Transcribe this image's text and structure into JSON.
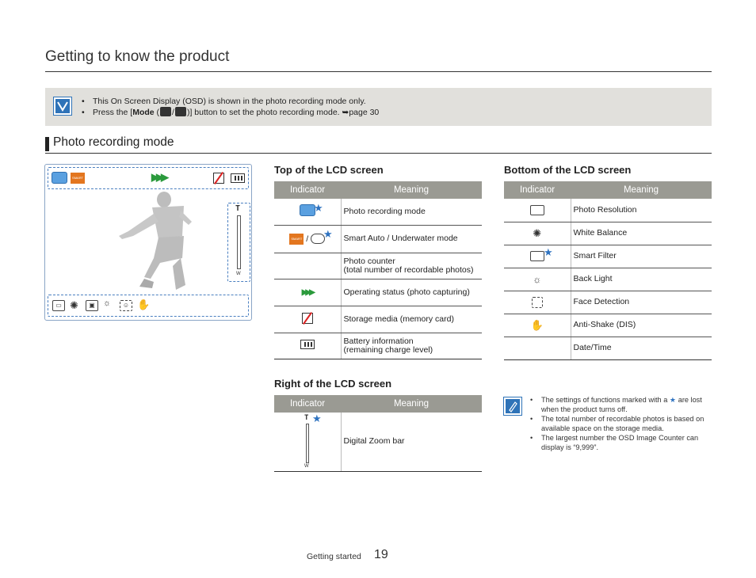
{
  "page": {
    "title": "Getting to know the product",
    "section_title": "Photo recording mode",
    "footer_label": "Getting started",
    "page_number": "19"
  },
  "note": {
    "icon": "note-check-icon",
    "line1": "This On Screen Display (OSD) is shown in the photo recording mode only.",
    "line2_pre": "Press the [",
    "line2_bold": "Mode",
    "line2_mid": " (",
    "line2_post": ")] button to set the photo recording mode. ",
    "line2_ref": "➥page 30"
  },
  "top_table": {
    "heading": "Top of the LCD screen",
    "col_indicator": "Indicator",
    "col_meaning": "Meaning",
    "rows": [
      {
        "icon": "photo-mode-icon",
        "meaning": "Photo recording mode",
        "star": true
      },
      {
        "icon": "smart-auto-underwater-icon",
        "sep": "/",
        "meaning": "Smart Auto / Underwater mode",
        "star": true
      },
      {
        "icon": "",
        "meaning_1": "Photo counter",
        "meaning_2": "(total number of recordable photos)"
      },
      {
        "icon": "operating-status-icon",
        "meaning": "Operating status (photo capturing)"
      },
      {
        "icon": "storage-media-icon",
        "meaning": "Storage media (memory card)"
      },
      {
        "icon": "battery-icon",
        "meaning_1": "Battery information",
        "meaning_2": "(remaining charge level)"
      }
    ]
  },
  "bottom_table": {
    "heading": "Bottom of the LCD screen",
    "col_indicator": "Indicator",
    "col_meaning": "Meaning",
    "rows": [
      {
        "icon": "photo-resolution-icon",
        "meaning": "Photo Resolution"
      },
      {
        "icon": "white-balance-icon",
        "meaning": "White Balance"
      },
      {
        "icon": "smart-filter-icon",
        "meaning": "Smart Filter",
        "star": true
      },
      {
        "icon": "back-light-icon",
        "meaning": "Back Light"
      },
      {
        "icon": "face-detection-icon",
        "meaning": "Face Detection"
      },
      {
        "icon": "anti-shake-icon",
        "meaning": "Anti-Shake (DIS)"
      },
      {
        "icon": "",
        "meaning": "Date/Time"
      }
    ]
  },
  "right_table": {
    "heading": "Right of the LCD screen",
    "col_indicator": "Indicator",
    "col_meaning": "Meaning",
    "rows": [
      {
        "icon": "digital-zoom-bar-icon",
        "meaning": "Digital Zoom bar",
        "star": true,
        "zoom_t": "T",
        "zoom_w": "W"
      }
    ]
  },
  "lcd": {
    "smart_text": "SMART",
    "zoom_t": "T",
    "zoom_w": "W"
  },
  "note2": {
    "icon": "note-pencil-icon",
    "line1_pre": "The settings of functions marked with a",
    "line1_post": "are lost when the product turns off.",
    "line2": "The total number of recordable photos is based on available space on the storage media.",
    "line3": "The largest number the OSD Image Counter can display is “9,999”."
  },
  "colors": {
    "accent_blue": "#2f73b8",
    "table_header": "#9a9a93",
    "status_green": "#2b9a3c",
    "smart_orange": "#e3761f"
  }
}
